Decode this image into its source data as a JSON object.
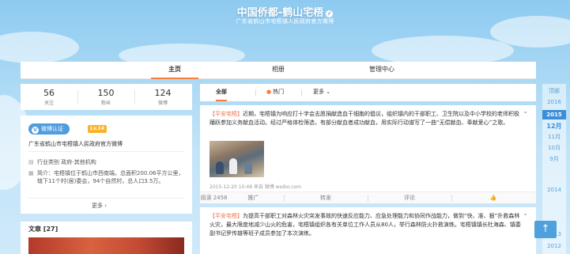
{
  "header": {
    "title": "中国侨都-鹤山宅梧",
    "subtitle": "广东省鹤山市宅梧镇人民政府官方微博"
  },
  "nav": {
    "tabs": [
      {
        "label": "主页"
      },
      {
        "label": "相册"
      },
      {
        "label": "管理中心"
      }
    ]
  },
  "stats": {
    "following": {
      "value": "56",
      "label": "关注"
    },
    "followers": {
      "value": "150",
      "label": "粉丝"
    },
    "posts": {
      "value": "124",
      "label": "微博"
    }
  },
  "profile": {
    "verify_label": "微博认证",
    "level": "Lv.14",
    "verify_text": "广东省鹤山市宅梧镇人民政府官方微博",
    "industry": "行业类别 政府-其他机构",
    "intro": "简介：宅梧镇位于鹤山市西南端，总面积200.06平方公里，辖下11个村(居)委会，94个自然村，总人口3.5万。",
    "more": "更多 ›"
  },
  "articles": {
    "title": "文章 [27]"
  },
  "feed": {
    "tabs": {
      "all": "全部",
      "hot": "热门",
      "more": "更多 ⌄"
    },
    "posts": [
      {
        "tag": "【平安宅梧】",
        "text": "近期，宅梧镇为响应打十字会志愿捐献造血干细胞的倡议，组织镇内的干部职工、卫生院以及中小学校的老师积极踊跃参加义务献血活动。经过严格体检筛选，有部分献血者成功献血，用实际行动谱写了一曲“无偿献血、奉献爱心”之歌。",
        "meta": "2015-12-20 10:48 来自 微博 weibo.com",
        "actions": [
          "阅读 2458",
          "推广",
          "转发",
          "评论",
          "👍"
        ]
      },
      {
        "tag": "【平安宅梧】",
        "text": "为提高干部职工对森林火灾突发事故的快速反应能力、应急处理能力和协同作战能力，做到“快、准、狠”扑救森林火灾，最大限度地减少山火的危害，宅梧镇组织各有关单位工作人员从80人，举行森林防火扑救演练。宅梧镇镇长杜海森、镇委副书记罗传雄等班子成员参加了本次演练。"
      }
    ]
  },
  "timeline": {
    "items": [
      "顶部",
      "2016",
      "2015",
      "12月",
      "11月",
      "10月",
      "9月",
      "2014",
      "2013",
      "2012"
    ]
  }
}
